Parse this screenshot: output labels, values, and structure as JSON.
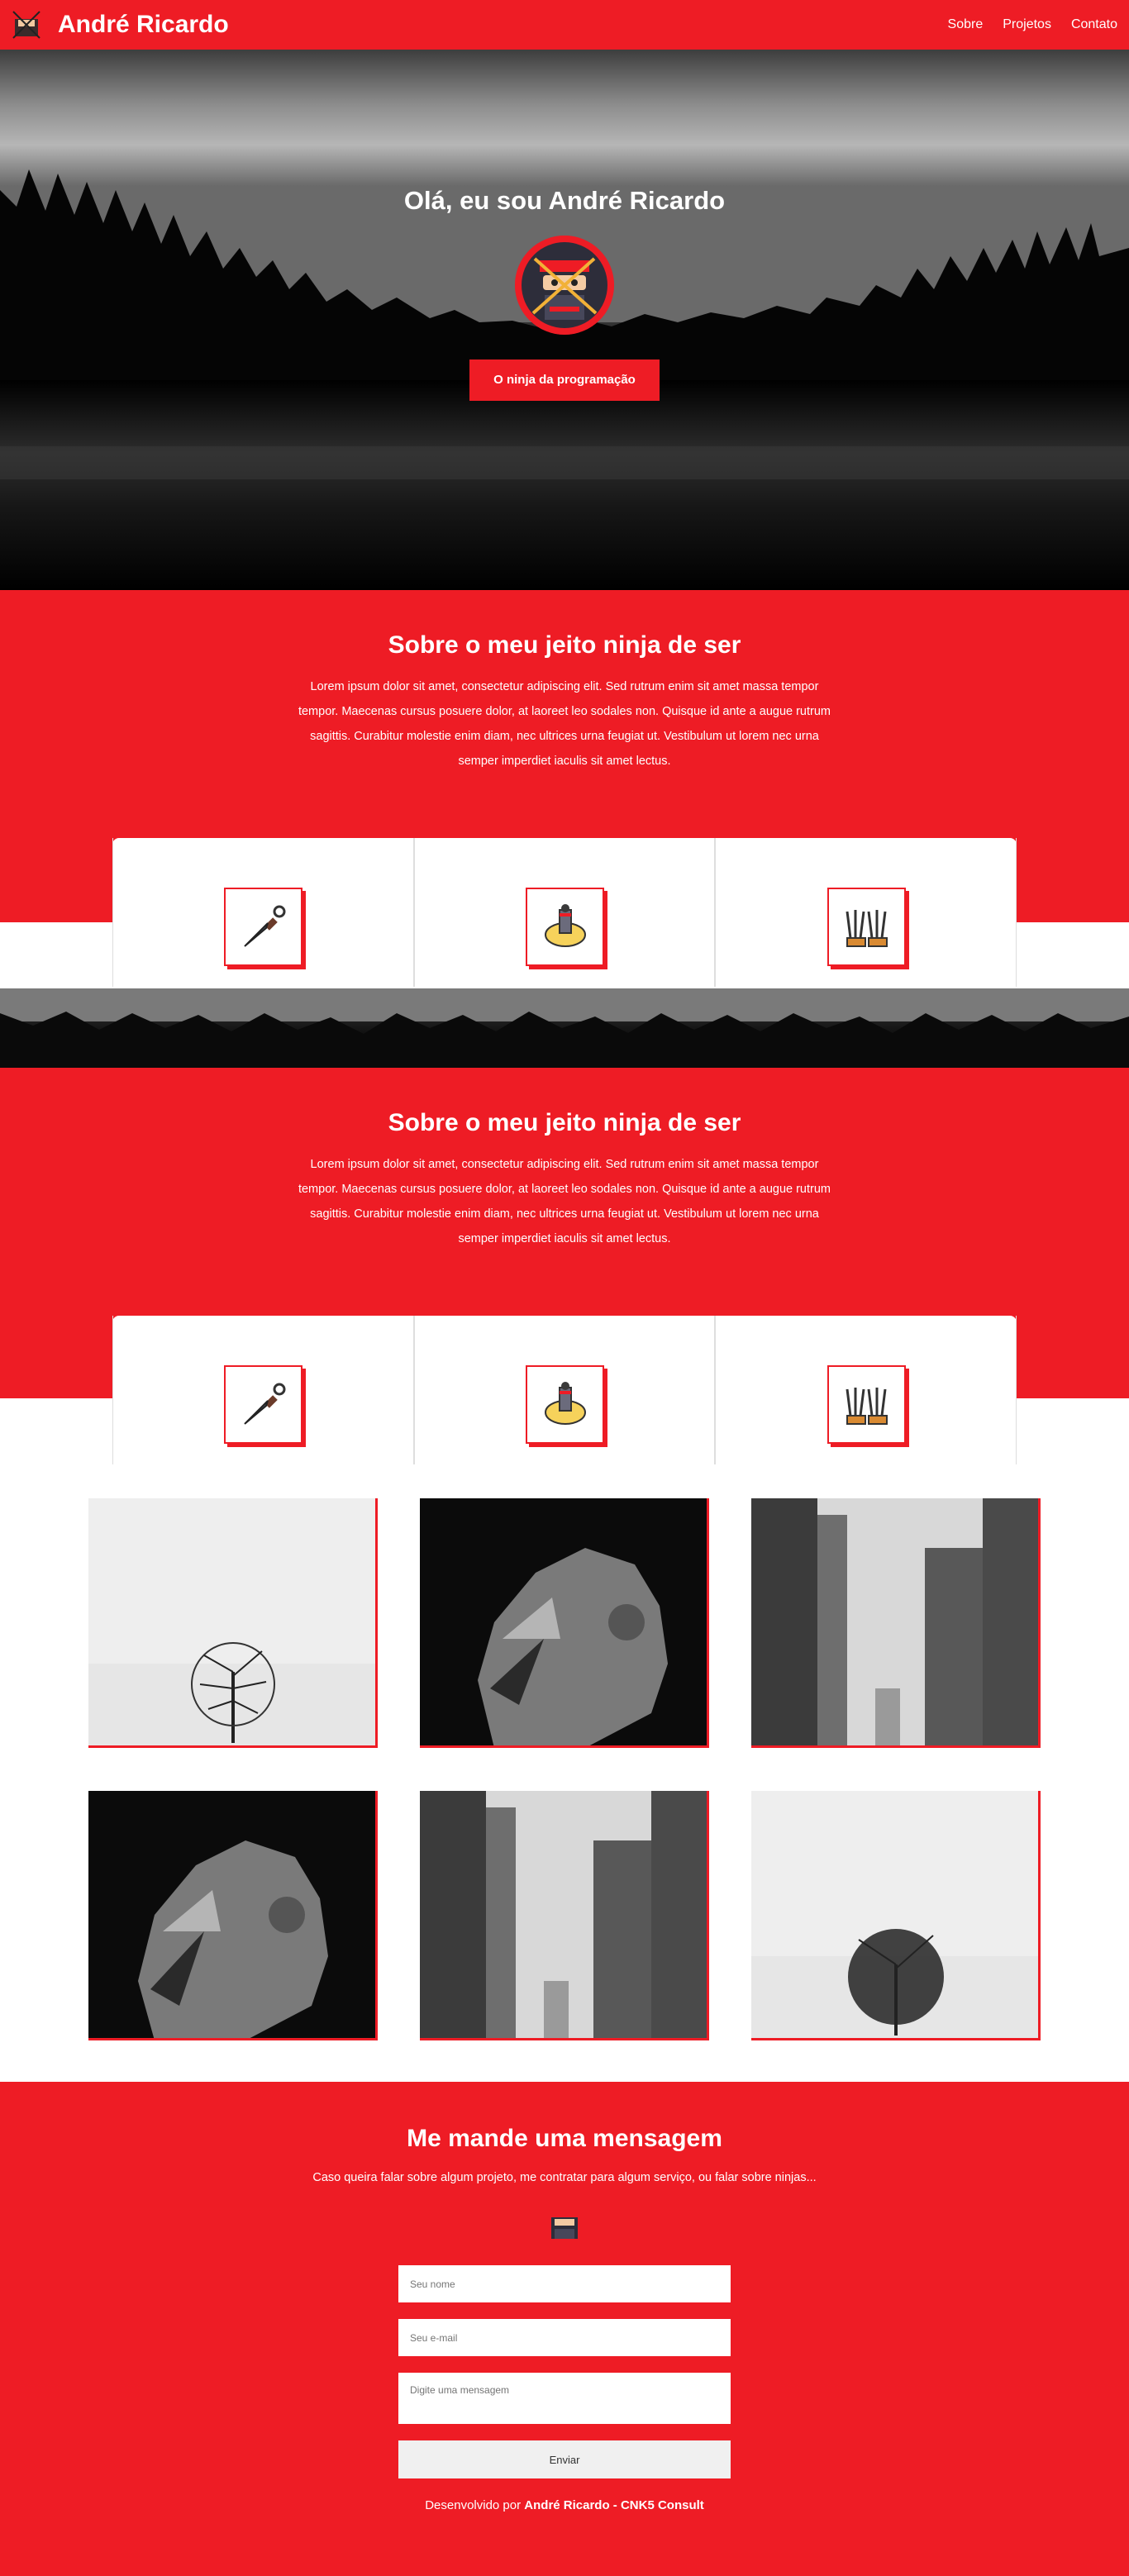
{
  "nav": {
    "brand": "André Ricardo",
    "links": [
      "Sobre",
      "Projetos",
      "Contato"
    ]
  },
  "hero": {
    "title": "Olá, eu sou André Ricardo",
    "cta": "O ninja da programação"
  },
  "about1": {
    "title": "Sobre o meu jeito ninja de ser",
    "text": "Lorem ipsum dolor sit amet, consectetur adipiscing elit. Sed rutrum enim sit amet massa tempor tempor. Maecenas cursus posuere dolor, at laoreet leo sodales non. Quisque id ante a augue rutrum sagittis. Curabitur molestie enim diam, nec ultrices urna feugiat ut. Vestibulum ut lorem nec urna semper imperdiet iaculis sit amet lectus."
  },
  "about2": {
    "title": "Sobre o meu jeito ninja de ser",
    "text": "Lorem ipsum dolor sit amet, consectetur adipiscing elit. Sed rutrum enim sit amet massa tempor tempor. Maecenas cursus posuere dolor, at laoreet leo sodales non. Quisque id ante a augue rutrum sagittis. Curabitur molestie enim diam, nec ultrices urna feugiat ut. Vestibulum ut lorem nec urna semper imperdiet iaculis sit amet lectus."
  },
  "cards": [
    "kunai-icon",
    "ninja-scroll-icon",
    "claws-icon"
  ],
  "gallery": [
    "tree",
    "lion",
    "buildings",
    "lion",
    "buildings",
    "tree"
  ],
  "contact": {
    "title": "Me mande uma mensagem",
    "lead": "Caso queira falar sobre algum projeto, me contratar para algum serviço, ou falar sobre ninjas...",
    "name_placeholder": "Seu nome",
    "email_placeholder": "Seu e-mail",
    "message_placeholder": "Digite uma mensagem",
    "send": "Enviar",
    "footer_prefix": "Desenvolvido por ",
    "footer_author": "André Ricardo - CNK5 Consult"
  },
  "colors": {
    "accent": "#ee1c25"
  }
}
